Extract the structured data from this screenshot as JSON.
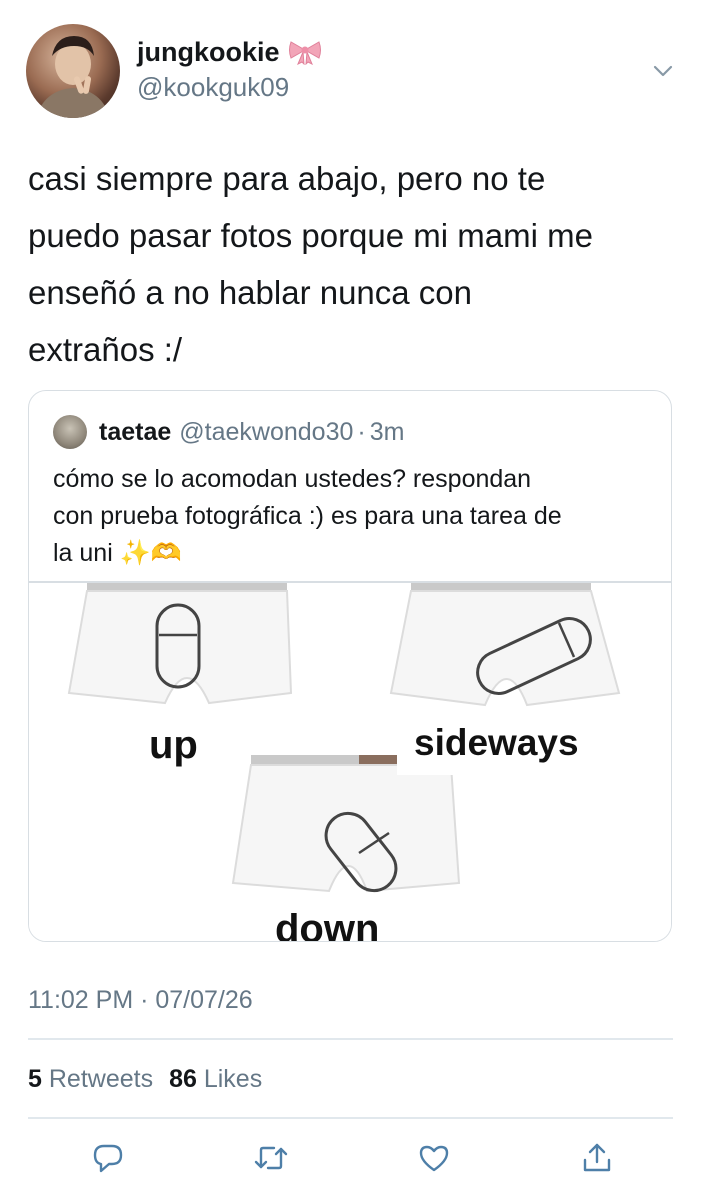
{
  "author": {
    "display_name": "jungkookie",
    "handle": "@kookguk09",
    "badge_icon": "ribbon-bow-icon"
  },
  "tweet": {
    "text": "casi siempre para abajo, pero no te\npuedo pasar fotos porque mi mami me\nenseñó a no hablar nunca con\nextraños :/",
    "timestamp": "11:02 PM · 07/07/26"
  },
  "quote": {
    "name": "taetae",
    "handle": "@taekwondo30",
    "separator": "·",
    "time": "3m",
    "text": "cómo se lo acomodan ustedes? respondan\ncon prueba fotográfica :) es para una tarea de\nla uni ✨🫶",
    "image_labels": {
      "up": "up",
      "sideways": "sideways",
      "down": "down"
    }
  },
  "stats": {
    "retweets_count": "5",
    "retweets_label": "Retweets",
    "likes_count": "86",
    "likes_label": "Likes"
  },
  "actions": [
    "reply-icon",
    "retweet-icon",
    "like-icon",
    "share-icon"
  ],
  "colors": {
    "text_primary": "#14171a",
    "text_secondary": "#657786",
    "border": "#d8dee3",
    "icon": "#4e7fa8",
    "bow": "#f2a5b8"
  }
}
